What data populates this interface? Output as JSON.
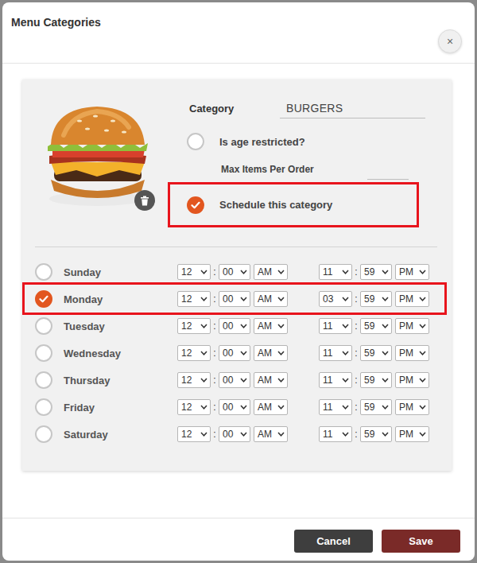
{
  "dialog": {
    "title": "Menu Categories",
    "close": "×"
  },
  "category": {
    "label": "Category",
    "value": "BURGERS"
  },
  "age_restricted": {
    "label": "Is age restricted?",
    "checked": false
  },
  "max_items": {
    "label": "Max Items Per Order",
    "value": ""
  },
  "schedule": {
    "label": "Schedule this category",
    "checked": true,
    "highlighted": true
  },
  "time_separator": ":",
  "days": [
    {
      "name": "Sunday",
      "selected": false,
      "highlighted": false,
      "start": {
        "hour": "12",
        "minute": "00",
        "period": "AM"
      },
      "end": {
        "hour": "11",
        "minute": "59",
        "period": "PM"
      }
    },
    {
      "name": "Monday",
      "selected": true,
      "highlighted": true,
      "start": {
        "hour": "12",
        "minute": "00",
        "period": "AM"
      },
      "end": {
        "hour": "03",
        "minute": "59",
        "period": "PM"
      }
    },
    {
      "name": "Tuesday",
      "selected": false,
      "highlighted": false,
      "start": {
        "hour": "12",
        "minute": "00",
        "period": "AM"
      },
      "end": {
        "hour": "11",
        "minute": "59",
        "period": "PM"
      }
    },
    {
      "name": "Wednesday",
      "selected": false,
      "highlighted": false,
      "start": {
        "hour": "12",
        "minute": "00",
        "period": "AM"
      },
      "end": {
        "hour": "11",
        "minute": "59",
        "period": "PM"
      }
    },
    {
      "name": "Thursday",
      "selected": false,
      "highlighted": false,
      "start": {
        "hour": "12",
        "minute": "00",
        "period": "AM"
      },
      "end": {
        "hour": "11",
        "minute": "59",
        "period": "PM"
      }
    },
    {
      "name": "Friday",
      "selected": false,
      "highlighted": false,
      "start": {
        "hour": "12",
        "minute": "00",
        "period": "AM"
      },
      "end": {
        "hour": "11",
        "minute": "59",
        "period": "PM"
      }
    },
    {
      "name": "Saturday",
      "selected": false,
      "highlighted": false,
      "start": {
        "hour": "12",
        "minute": "00",
        "period": "AM"
      },
      "end": {
        "hour": "11",
        "minute": "59",
        "period": "PM"
      }
    }
  ],
  "buttons": [
    {
      "label": "Cancel",
      "kind": "secondary"
    },
    {
      "label": "Save",
      "kind": "primary"
    }
  ]
}
